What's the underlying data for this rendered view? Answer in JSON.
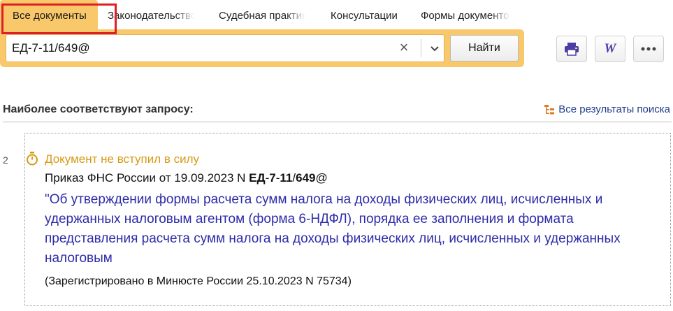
{
  "tabs": [
    {
      "label": "Все документы",
      "active": true
    },
    {
      "label": "Законодательство",
      "active": false
    },
    {
      "label": "Судебная практика",
      "active": false
    },
    {
      "label": "Консультации",
      "active": false
    },
    {
      "label": "Формы документов",
      "active": false
    }
  ],
  "search": {
    "value": "ЕД-7-11/649@",
    "clear_label": "×",
    "find_label": "Найти"
  },
  "toolbar": {
    "print_icon": "printer-icon",
    "word_label": "W",
    "more_label": "•••"
  },
  "results": {
    "header": "Наиболее соответствуют запросу:",
    "all_results_label": "Все результаты поиска",
    "items": [
      {
        "number": "2",
        "status": "Документ не вступил в силу",
        "doc_prefix": "Приказ ФНС России от 19.09.2023 N ",
        "doc_parts": [
          "ЕД",
          "-",
          "7",
          "-",
          "11",
          "/",
          "649",
          "@"
        ],
        "title": "\"Об утверждении формы расчета сумм налога на доходы физических лиц, исчисленных и удержанных налоговым агентом (форма 6-НДФЛ), порядка ее заполнения и формата представления расчета сумм налога на доходы физических лиц, исчисленных и удержанных налоговым",
        "registration": "(Зарегистрировано в Минюсте России 25.10.2023 N 75734)"
      }
    ]
  },
  "colors": {
    "accent": "#f9c86a",
    "link": "#2d2ba8",
    "status": "#d79a16",
    "highlight": "#e01e26"
  }
}
